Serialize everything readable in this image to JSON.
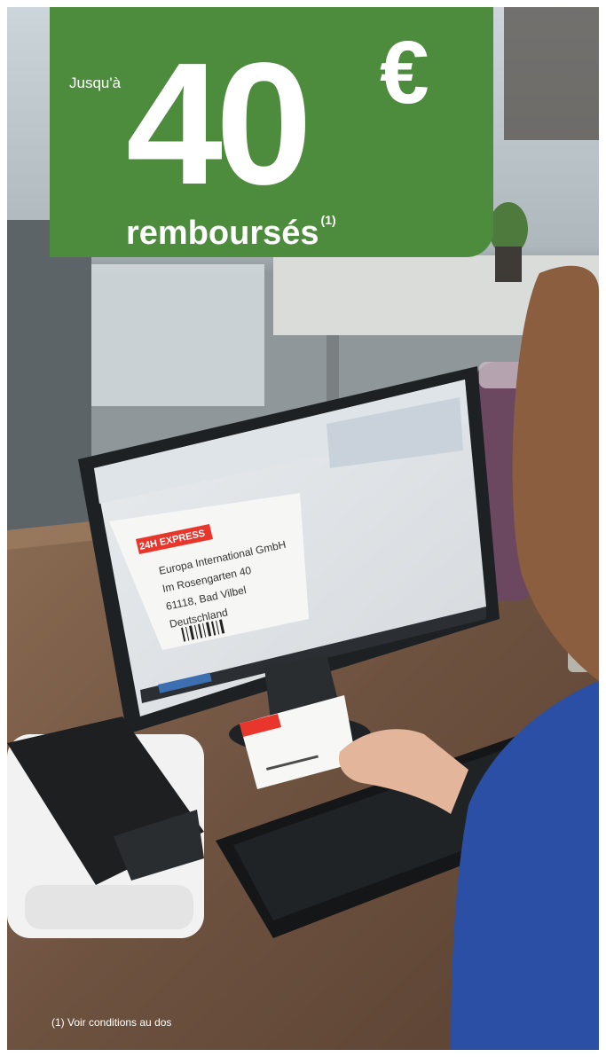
{
  "promo": {
    "prefix": "Jusqu'à",
    "amount": "40",
    "currency": "€",
    "label": "remboursés",
    "note_ref": "(1)"
  },
  "footnote": "(1) Voir conditions au dos",
  "photo": {
    "label": {
      "badge": "24H EXPRESS",
      "lines": [
        "Europa International GmbH",
        "Im Rosengarten 40",
        "61118, Bad Vilbel",
        "Deutschland"
      ]
    }
  },
  "colors": {
    "promo_green": "#4c8c3c",
    "badge_red": "#e8362c"
  }
}
